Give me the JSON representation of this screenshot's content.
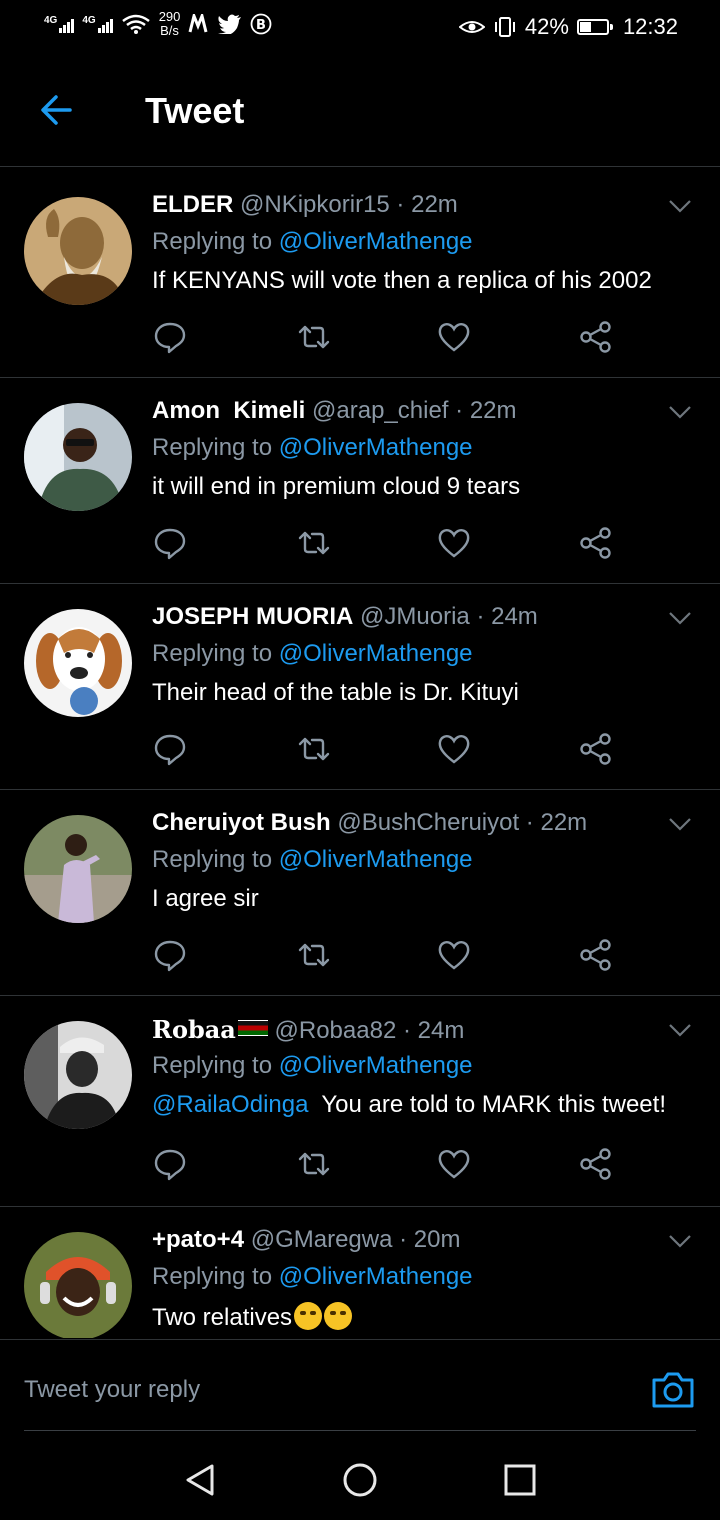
{
  "status_bar": {
    "net1": "4G",
    "net2": "4G",
    "speed_value": "290",
    "speed_unit": "B/s",
    "battery_percent": "42%",
    "battery_level": 0.42,
    "time": "12:32"
  },
  "header": {
    "title": "Tweet"
  },
  "tweets": [
    {
      "name": "ELDER",
      "handle": "@NKipkorir15",
      "time": "22m",
      "replying_prefix": "Replying to",
      "replying_to": "@OliverMathenge",
      "text": "If KENYANS will vote then a replica of his 2002"
    },
    {
      "name": "Amon  Kimeli",
      "handle": "@arap_chief",
      "time": "22m",
      "replying_prefix": "Replying to",
      "replying_to": "@OliverMathenge",
      "text": "it will end in premium cloud 9 tears"
    },
    {
      "name": "JOSEPH MUORIA",
      "handle": "@JMuoria",
      "time": "24m",
      "replying_prefix": "Replying to",
      "replying_to": "@OliverMathenge",
      "text": "Their head of the table is Dr. Kituyi"
    },
    {
      "name": "Cheruiyot Bush",
      "handle": "@BushCheruiyot",
      "time": "22m",
      "replying_prefix": "Replying to",
      "replying_to": "@OliverMathenge",
      "text": "I agree sir"
    },
    {
      "name": "Robaa",
      "handle": "@Robaa82",
      "time": "24m",
      "replying_prefix": "Replying to",
      "replying_to": "@OliverMathenge",
      "mention": "@RailaOdinga",
      "text": "You are told to MARK this tweet!"
    },
    {
      "name": "+pato+4",
      "handle": "@GMaregwa",
      "time": "20m",
      "replying_prefix": "Replying to",
      "replying_to": "@OliverMathenge",
      "text": "Two relatives"
    }
  ],
  "reply_bar": {
    "placeholder": "Tweet your reply"
  },
  "colors": {
    "accent": "#1d9bf0",
    "muted": "#8b98a5",
    "divider": "#2f3336"
  },
  "icons": [
    "back-arrow-icon",
    "chevron-down-icon",
    "comment-icon",
    "retweet-icon",
    "like-icon",
    "share-icon",
    "camera-icon",
    "nav-back-icon",
    "nav-home-icon",
    "nav-recents-icon"
  ]
}
